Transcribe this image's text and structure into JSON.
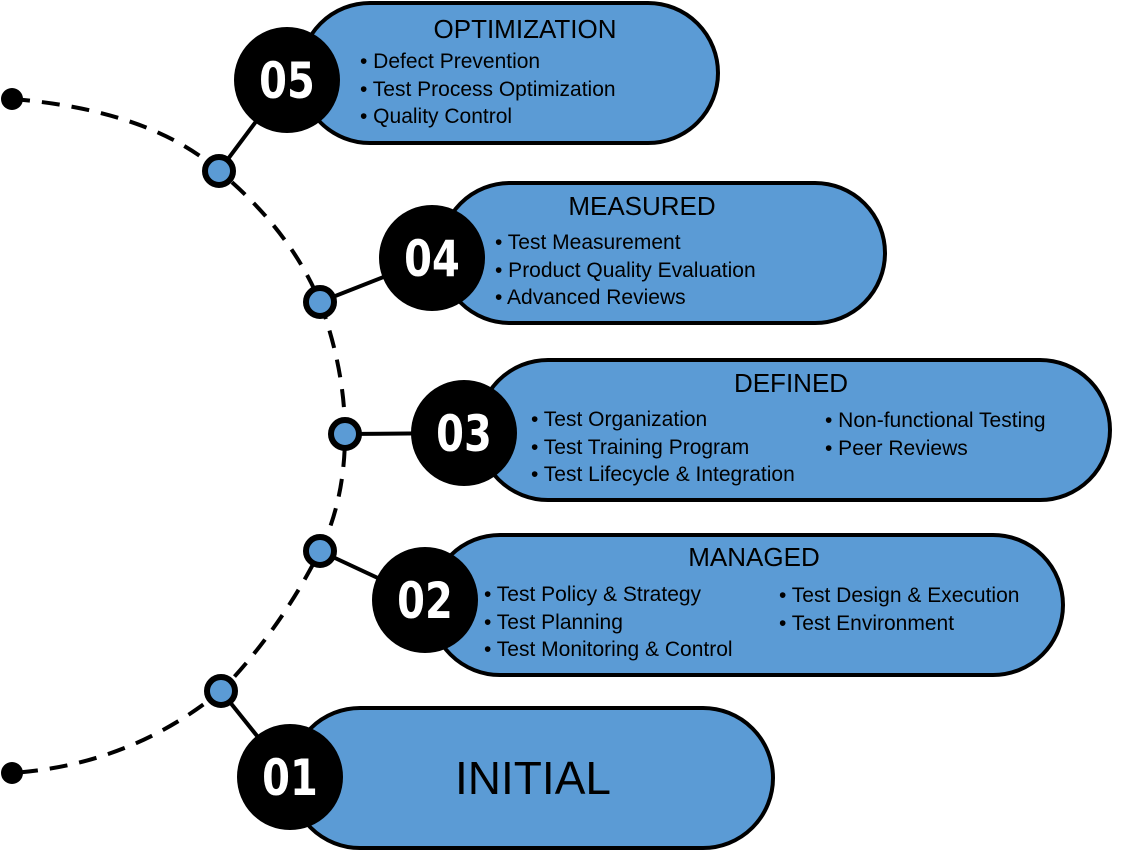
{
  "colors": {
    "pill": "#5b9bd5",
    "badge": "#000000",
    "outline": "#000000"
  },
  "levels": [
    {
      "number": "05",
      "title": "OPTIMIZATION",
      "items": [
        "• Defect Prevention",
        "• Test Process Optimization",
        "• Quality Control"
      ]
    },
    {
      "number": "04",
      "title": "MEASURED",
      "items": [
        "• Test Measurement",
        "• Product Quality Evaluation",
        "• Advanced Reviews"
      ]
    },
    {
      "number": "03",
      "title": "DEFINED",
      "items": [
        "• Test Organization",
        "• Test Training Program",
        "• Test Lifecycle & Integration",
        "• Non-functional Testing",
        "• Peer Reviews"
      ]
    },
    {
      "number": "02",
      "title": "MANAGED",
      "items": [
        "• Test Policy & Strategy",
        "• Test Planning",
        "• Test Monitoring & Control",
        "• Test Design & Execution",
        "• Test Environment"
      ]
    },
    {
      "number": "01",
      "title": "INITIAL",
      "items": []
    }
  ]
}
